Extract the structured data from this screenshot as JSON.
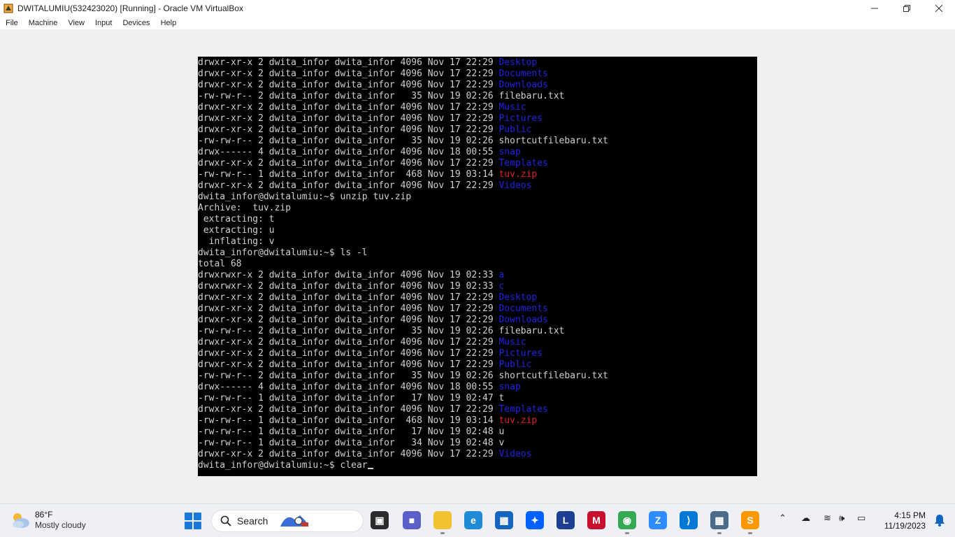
{
  "window": {
    "title": "DWITALUMIU(532423020) [Running] - Oracle VM VirtualBox",
    "controls": [
      "minimize-icon",
      "restore-icon",
      "close-icon"
    ]
  },
  "menu": [
    "File",
    "Machine",
    "View",
    "Input",
    "Devices",
    "Help"
  ],
  "terminal": {
    "lines": [
      [
        {
          "t": "drwxr-xr-x 2 dwita_infor dwita_infor 4096 Nov 17 22:29 "
        },
        {
          "t": "Desktop",
          "c": "blue"
        }
      ],
      [
        {
          "t": "drwxr-xr-x 2 dwita_infor dwita_infor 4096 Nov 17 22:29 "
        },
        {
          "t": "Documents",
          "c": "blue"
        }
      ],
      [
        {
          "t": "drwxr-xr-x 2 dwita_infor dwita_infor 4096 Nov 17 22:29 "
        },
        {
          "t": "Downloads",
          "c": "blue"
        }
      ],
      [
        {
          "t": "-rw-rw-r-- 2 dwita_infor dwita_infor   35 Nov 19 02:26 filebaru.txt"
        }
      ],
      [
        {
          "t": "drwxr-xr-x 2 dwita_infor dwita_infor 4096 Nov 17 22:29 "
        },
        {
          "t": "Music",
          "c": "blue"
        }
      ],
      [
        {
          "t": "drwxr-xr-x 2 dwita_infor dwita_infor 4096 Nov 17 22:29 "
        },
        {
          "t": "Pictures",
          "c": "blue"
        }
      ],
      [
        {
          "t": "drwxr-xr-x 2 dwita_infor dwita_infor 4096 Nov 17 22:29 "
        },
        {
          "t": "Public",
          "c": "blue"
        }
      ],
      [
        {
          "t": "-rw-rw-r-- 2 dwita_infor dwita_infor   35 Nov 19 02:26 shortcutfilebaru.txt"
        }
      ],
      [
        {
          "t": "drwx------ 4 dwita_infor dwita_infor 4096 Nov 18 00:55 "
        },
        {
          "t": "snap",
          "c": "blue"
        }
      ],
      [
        {
          "t": "drwxr-xr-x 2 dwita_infor dwita_infor 4096 Nov 17 22:29 "
        },
        {
          "t": "Templates",
          "c": "blue"
        }
      ],
      [
        {
          "t": "-rw-rw-r-- 1 dwita_infor dwita_infor  468 Nov 19 03:14 "
        },
        {
          "t": "tuv.zip",
          "c": "red"
        }
      ],
      [
        {
          "t": "drwxr-xr-x 2 dwita_infor dwita_infor 4096 Nov 17 22:29 "
        },
        {
          "t": "Videos",
          "c": "blue"
        }
      ],
      [
        {
          "t": "dwita_infor@dwitalumiu:~$ unzip tuv.zip"
        }
      ],
      [
        {
          "t": "Archive:  tuv.zip"
        }
      ],
      [
        {
          "t": " extracting: t"
        }
      ],
      [
        {
          "t": " extracting: u"
        }
      ],
      [
        {
          "t": "  inflating: v"
        }
      ],
      [
        {
          "t": "dwita_infor@dwitalumiu:~$ ls -l"
        }
      ],
      [
        {
          "t": "total 68"
        }
      ],
      [
        {
          "t": "drwxrwxr-x 2 dwita_infor dwita_infor 4096 Nov 19 02:33 "
        },
        {
          "t": "a",
          "c": "blue"
        }
      ],
      [
        {
          "t": "drwxrwxr-x 2 dwita_infor dwita_infor 4096 Nov 19 02:33 "
        },
        {
          "t": "c",
          "c": "blue"
        }
      ],
      [
        {
          "t": "drwxr-xr-x 2 dwita_infor dwita_infor 4096 Nov 17 22:29 "
        },
        {
          "t": "Desktop",
          "c": "blue"
        }
      ],
      [
        {
          "t": "drwxr-xr-x 2 dwita_infor dwita_infor 4096 Nov 17 22:29 "
        },
        {
          "t": "Documents",
          "c": "blue"
        }
      ],
      [
        {
          "t": "drwxr-xr-x 2 dwita_infor dwita_infor 4096 Nov 17 22:29 "
        },
        {
          "t": "Downloads",
          "c": "blue"
        }
      ],
      [
        {
          "t": "-rw-rw-r-- 2 dwita_infor dwita_infor   35 Nov 19 02:26 filebaru.txt"
        }
      ],
      [
        {
          "t": "drwxr-xr-x 2 dwita_infor dwita_infor 4096 Nov 17 22:29 "
        },
        {
          "t": "Music",
          "c": "blue"
        }
      ],
      [
        {
          "t": "drwxr-xr-x 2 dwita_infor dwita_infor 4096 Nov 17 22:29 "
        },
        {
          "t": "Pictures",
          "c": "blue"
        }
      ],
      [
        {
          "t": "drwxr-xr-x 2 dwita_infor dwita_infor 4096 Nov 17 22:29 "
        },
        {
          "t": "Public",
          "c": "blue"
        }
      ],
      [
        {
          "t": "-rw-rw-r-- 2 dwita_infor dwita_infor   35 Nov 19 02:26 shortcutfilebaru.txt"
        }
      ],
      [
        {
          "t": "drwx------ 4 dwita_infor dwita_infor 4096 Nov 18 00:55 "
        },
        {
          "t": "snap",
          "c": "blue"
        }
      ],
      [
        {
          "t": "-rw-rw-r-- 1 dwita_infor dwita_infor   17 Nov 19 02:47 t"
        }
      ],
      [
        {
          "t": "drwxr-xr-x 2 dwita_infor dwita_infor 4096 Nov 17 22:29 "
        },
        {
          "t": "Templates",
          "c": "blue"
        }
      ],
      [
        {
          "t": "-rw-rw-r-- 1 dwita_infor dwita_infor  468 Nov 19 03:14 "
        },
        {
          "t": "tuv.zip",
          "c": "red"
        }
      ],
      [
        {
          "t": "-rw-rw-r-- 1 dwita_infor dwita_infor   17 Nov 19 02:48 u"
        }
      ],
      [
        {
          "t": "-rw-rw-r-- 1 dwita_infor dwita_infor   34 Nov 19 02:48 v"
        }
      ],
      [
        {
          "t": "drwxr-xr-x 2 dwita_infor dwita_infor 4096 Nov 17 22:29 "
        },
        {
          "t": "Videos",
          "c": "blue"
        }
      ],
      [
        {
          "t": "dwita_infor@dwitalumiu:~$ clear"
        },
        {
          "cursor": true
        }
      ]
    ],
    "colors": {
      "blue": "#2323e0",
      "red": "#e02020",
      "text": "#d0d0d0",
      "background": "#000000"
    }
  },
  "taskbar": {
    "weather": {
      "temp": "86°F",
      "desc": "Mostly cloudy",
      "icon": "cloud-sun-icon"
    },
    "search_label": "Search",
    "apps": [
      {
        "name": "taskview-icon",
        "glyph": "▣",
        "bg": "#2b2b2b",
        "dot": false
      },
      {
        "name": "teams-meet-icon",
        "glyph": "■",
        "bg": "#5b5fc7",
        "dot": false
      },
      {
        "name": "file-explorer-icon",
        "glyph": "",
        "bg": "#f2c230",
        "dot": true
      },
      {
        "name": "edge-icon",
        "glyph": "e",
        "bg": "#1f8ad6",
        "dot": false
      },
      {
        "name": "store-icon",
        "glyph": "▦",
        "bg": "#1565c0",
        "dot": false
      },
      {
        "name": "dropbox-icon",
        "glyph": "✦",
        "bg": "#0061fe",
        "dot": false
      },
      {
        "name": "l-app-icon",
        "glyph": "L",
        "bg": "#1c3f94",
        "dot": false
      },
      {
        "name": "mcafee-icon",
        "glyph": "M",
        "bg": "#c8102e",
        "dot": false
      },
      {
        "name": "chrome-icon",
        "glyph": "◉",
        "bg": "#34a853",
        "dot": true
      },
      {
        "name": "zoom-icon",
        "glyph": "Z",
        "bg": "#2d8cff",
        "dot": false
      },
      {
        "name": "vscode-icon",
        "glyph": "⟩",
        "bg": "#0078d4",
        "dot": false
      },
      {
        "name": "virtualbox-icon",
        "glyph": "▩",
        "bg": "#4a6b8a",
        "dot": true
      },
      {
        "name": "sublime-icon",
        "glyph": "S",
        "bg": "#ff9800",
        "dot": true
      }
    ],
    "tray": [
      {
        "name": "chevron-up-icon",
        "glyph": "⌃"
      },
      {
        "name": "onedrive-icon",
        "glyph": "☁"
      },
      {
        "name": "wifi-icon",
        "glyph": "≋"
      },
      {
        "name": "volume-icon",
        "glyph": "🕪"
      },
      {
        "name": "battery-icon",
        "glyph": "▭"
      }
    ],
    "time": "4:15 PM",
    "date": "11/19/2023",
    "notification_icon": "bell-icon"
  }
}
